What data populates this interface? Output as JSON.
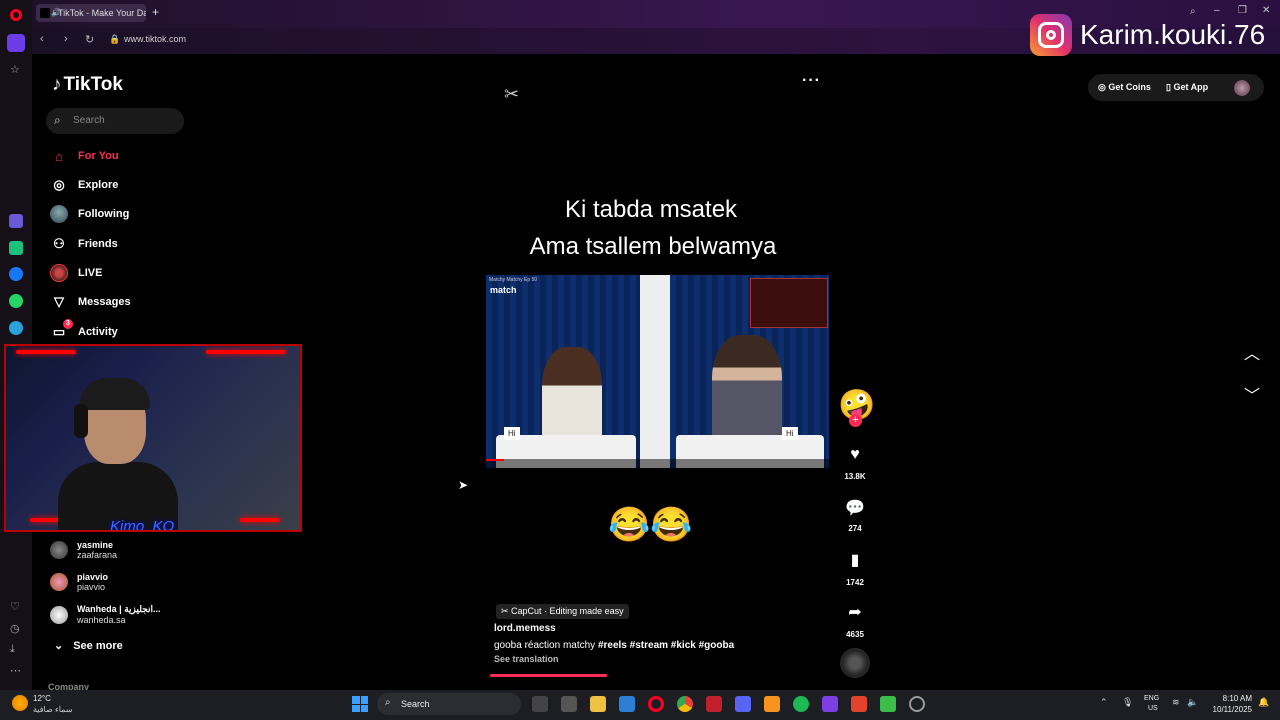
{
  "browser": {
    "tab_title": "TikTok - Make Your Day",
    "new_tab": "+",
    "url": "www.tiktok.com",
    "back": "‹",
    "forward": "›",
    "reload": "↻"
  },
  "overlay": {
    "ig_handle": "Karim.kouki.76"
  },
  "sidebar": {
    "logo": "TikTok",
    "search_placeholder": "Search",
    "nav": [
      {
        "label": "For You"
      },
      {
        "label": "Explore"
      },
      {
        "label": "Following"
      },
      {
        "label": "Friends"
      },
      {
        "label": "LIVE"
      },
      {
        "label": "Messages"
      },
      {
        "label": "Activity",
        "badge": "3"
      }
    ],
    "accounts": [
      {
        "name": "yasmine",
        "handle": "zaafarana"
      },
      {
        "name": "piavvio",
        "handle": "piavvio"
      },
      {
        "name": "Wanheda | انجليزية...",
        "handle": "wanheda.sa"
      }
    ],
    "see_more": "See more",
    "company": "Company"
  },
  "webcam": {
    "label": "Kimo_KO"
  },
  "video": {
    "caption_line1": "Ki tabda msatek",
    "caption_line2": "Ama tsallem belwamya",
    "clip_brand": "match",
    "clip_subtitle": "Matchy Matchy Ep 50",
    "hi_left": "Hi",
    "hi_right": "Hi",
    "emoji": "😂😂",
    "effect": "CapCut · Editing made easy",
    "author": "lord.memess",
    "description": "gooba réaction matchy",
    "tags": [
      "#reels",
      "#stream",
      "#kick",
      "#gooba"
    ],
    "see_translation": "See translation",
    "more": "···",
    "progress": 0.34
  },
  "actions": {
    "likes": "13.8K",
    "comments": "274",
    "saves": "1742",
    "shares": "4635"
  },
  "header": {
    "get_coins": "Get Coins",
    "get_app": "Get App"
  },
  "taskbar": {
    "temp": "12°C",
    "weather": "سماء صافية",
    "search": "Search",
    "lang1": "ENG",
    "lang2": "US",
    "time": "8:10 AM",
    "date": "10/11/2025"
  },
  "colors": {
    "accent": "#fe2c55",
    "brand_ig": "#e1306c"
  }
}
